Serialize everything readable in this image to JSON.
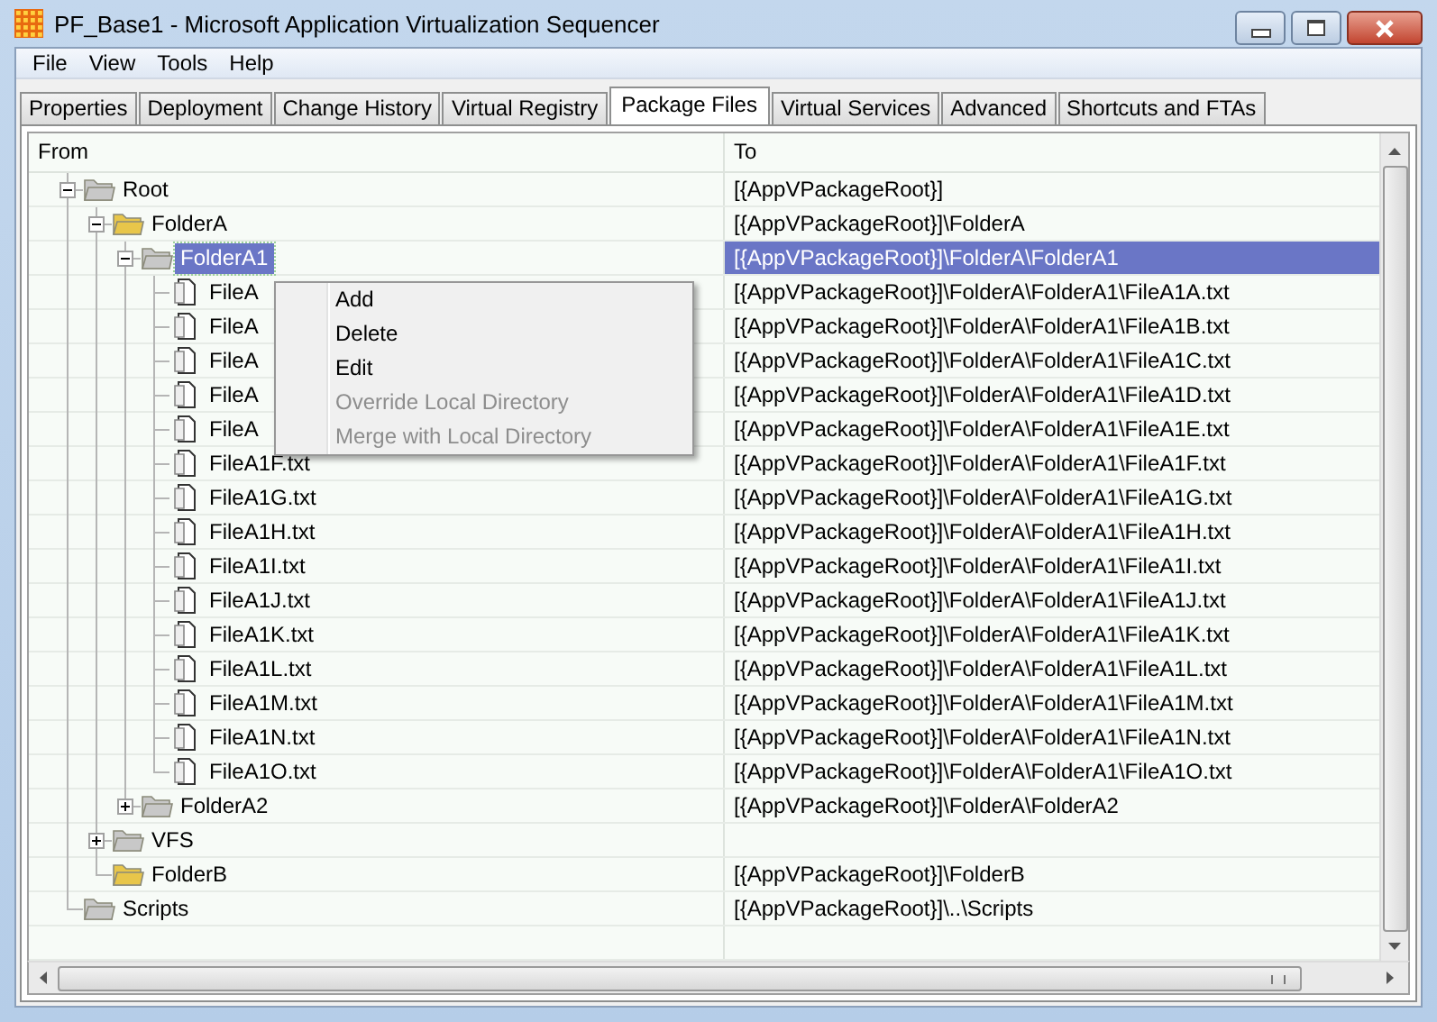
{
  "window": {
    "title": "PF_Base1 - Microsoft Application Virtualization Sequencer"
  },
  "menu_bar": [
    "File",
    "View",
    "Tools",
    "Help"
  ],
  "tabs": [
    {
      "label": "Properties",
      "selected": false
    },
    {
      "label": "Deployment",
      "selected": false
    },
    {
      "label": "Change History",
      "selected": false
    },
    {
      "label": "Virtual Registry",
      "selected": false
    },
    {
      "label": "Package Files",
      "selected": true
    },
    {
      "label": "Virtual Services",
      "selected": false
    },
    {
      "label": "Advanced",
      "selected": false
    },
    {
      "label": "Shortcuts and FTAs",
      "selected": false
    }
  ],
  "table": {
    "columns": [
      "From",
      "To"
    ],
    "tree": [
      {
        "name": "Root",
        "to": "[{AppVPackageRoot}]",
        "kind": "folder",
        "color": "#c8c8c8",
        "expanded": true,
        "selected": false,
        "children": [
          {
            "name": "FolderA",
            "to": "[{AppVPackageRoot}]\\FolderA",
            "kind": "folder",
            "color": "#e8c64a",
            "expanded": true,
            "selected": false,
            "children": [
              {
                "name": "FolderA1",
                "to": "[{AppVPackageRoot}]\\FolderA\\FolderA1",
                "kind": "folder",
                "color": "#c8c8c8",
                "expanded": true,
                "selected": true,
                "children": [
                  {
                    "name": "FileA",
                    "to": "[{AppVPackageRoot}]\\FolderA\\FolderA1\\FileA1A.txt",
                    "kind": "file",
                    "selected": false
                  },
                  {
                    "name": "FileA",
                    "to": "[{AppVPackageRoot}]\\FolderA\\FolderA1\\FileA1B.txt",
                    "kind": "file",
                    "selected": false
                  },
                  {
                    "name": "FileA",
                    "to": "[{AppVPackageRoot}]\\FolderA\\FolderA1\\FileA1C.txt",
                    "kind": "file",
                    "selected": false
                  },
                  {
                    "name": "FileA",
                    "to": "[{AppVPackageRoot}]\\FolderA\\FolderA1\\FileA1D.txt",
                    "kind": "file",
                    "selected": false
                  },
                  {
                    "name": "FileA",
                    "to": "[{AppVPackageRoot}]\\FolderA\\FolderA1\\FileA1E.txt",
                    "kind": "file",
                    "selected": false
                  },
                  {
                    "name": "FileA1F.txt",
                    "to": "[{AppVPackageRoot}]\\FolderA\\FolderA1\\FileA1F.txt",
                    "kind": "file",
                    "selected": false
                  },
                  {
                    "name": "FileA1G.txt",
                    "to": "[{AppVPackageRoot}]\\FolderA\\FolderA1\\FileA1G.txt",
                    "kind": "file",
                    "selected": false
                  },
                  {
                    "name": "FileA1H.txt",
                    "to": "[{AppVPackageRoot}]\\FolderA\\FolderA1\\FileA1H.txt",
                    "kind": "file",
                    "selected": false
                  },
                  {
                    "name": "FileA1I.txt",
                    "to": "[{AppVPackageRoot}]\\FolderA\\FolderA1\\FileA1I.txt",
                    "kind": "file",
                    "selected": false
                  },
                  {
                    "name": "FileA1J.txt",
                    "to": "[{AppVPackageRoot}]\\FolderA\\FolderA1\\FileA1J.txt",
                    "kind": "file",
                    "selected": false
                  },
                  {
                    "name": "FileA1K.txt",
                    "to": "[{AppVPackageRoot}]\\FolderA\\FolderA1\\FileA1K.txt",
                    "kind": "file",
                    "selected": false
                  },
                  {
                    "name": "FileA1L.txt",
                    "to": "[{AppVPackageRoot}]\\FolderA\\FolderA1\\FileA1L.txt",
                    "kind": "file",
                    "selected": false
                  },
                  {
                    "name": "FileA1M.txt",
                    "to": "[{AppVPackageRoot}]\\FolderA\\FolderA1\\FileA1M.txt",
                    "kind": "file",
                    "selected": false
                  },
                  {
                    "name": "FileA1N.txt",
                    "to": "[{AppVPackageRoot}]\\FolderA\\FolderA1\\FileA1N.txt",
                    "kind": "file",
                    "selected": false
                  },
                  {
                    "name": "FileA1O.txt",
                    "to": "[{AppVPackageRoot}]\\FolderA\\FolderA1\\FileA1O.txt",
                    "kind": "file",
                    "selected": false
                  }
                ]
              },
              {
                "name": "FolderA2",
                "to": "[{AppVPackageRoot}]\\FolderA\\FolderA2",
                "kind": "folder",
                "color": "#c8c8c8",
                "expanded": false,
                "selected": false
              }
            ]
          },
          {
            "name": "VFS",
            "kind": "folder",
            "color": "#c8c8c8",
            "expanded": false,
            "selected": false
          },
          {
            "name": "FolderB",
            "to": "[{AppVPackageRoot}]\\FolderB",
            "kind": "folder",
            "color": "#e8c64a",
            "selected": false
          }
        ]
      },
      {
        "name": "Scripts",
        "to": "[{AppVPackageRoot}]\\..\\Scripts",
        "kind": "folder",
        "color": "#c8c8c8",
        "selected": false
      }
    ]
  },
  "context_menu": [
    {
      "label": "Add",
      "disabled": false
    },
    {
      "label": "Delete",
      "disabled": false
    },
    {
      "label": "Edit",
      "disabled": false
    },
    {
      "label": "Override Local Directory",
      "disabled": true
    },
    {
      "label": "Merge with Local Directory",
      "disabled": true
    }
  ]
}
